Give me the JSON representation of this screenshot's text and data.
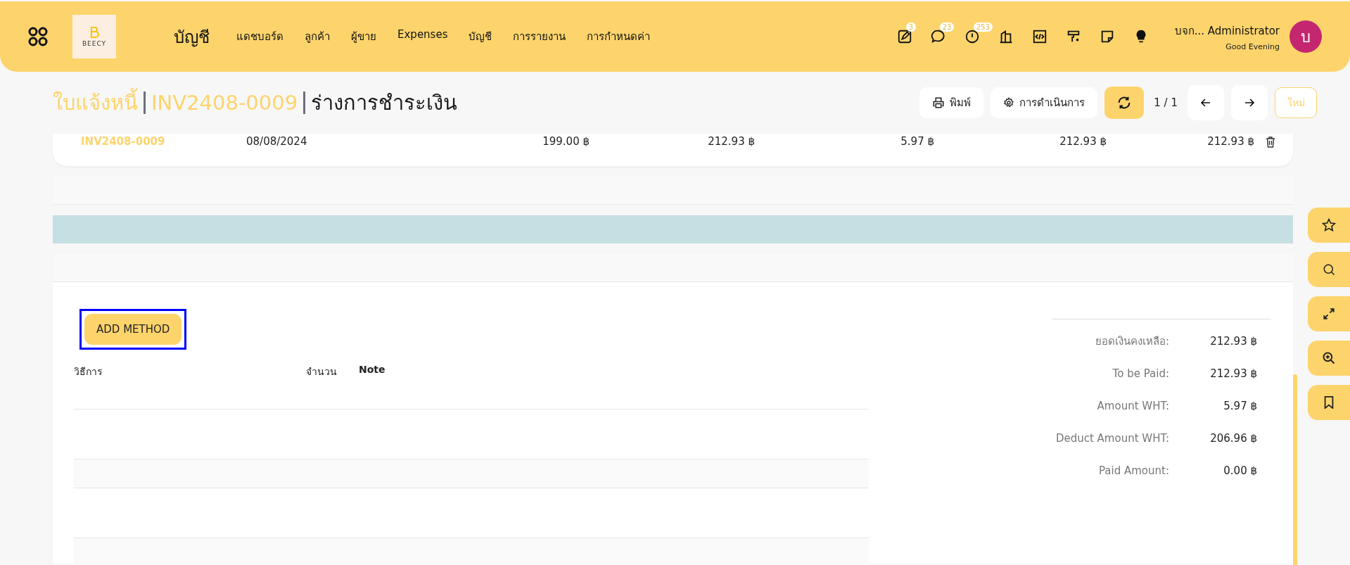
{
  "header": {
    "logo_text": "BEECY",
    "module_title": "บัญชี",
    "nav_items": [
      "แดชบอร์ด",
      "ลูกค้า",
      "ผู้ขาย",
      "Expenses",
      "บัญชี",
      "การรายงาน",
      "การกำหนดค่า"
    ],
    "icons": [
      {
        "kind": "note",
        "badge": "3"
      },
      {
        "kind": "chat",
        "badge": "23"
      },
      {
        "kind": "clock",
        "badge": "253"
      },
      {
        "kind": "building"
      },
      {
        "kind": "code"
      },
      {
        "kind": "brush"
      },
      {
        "kind": "sticky"
      },
      {
        "kind": "bulb"
      }
    ],
    "user": {
      "name": "บจก... Administrator",
      "greeting": "Good Evening",
      "avatar_letter": "บ"
    }
  },
  "breadcrumb": [
    {
      "label": "ใบแจ้งหนี้",
      "kind": "link"
    },
    {
      "label": "INV2408-0009",
      "kind": "link"
    },
    {
      "label": "ร่างการชำระเงิน",
      "kind": "current"
    }
  ],
  "toolbar": {
    "print": "พิมพ์",
    "actions": "การดำเนินการ",
    "pager": "1 / 1",
    "new": "ใหม่"
  },
  "invoice_row": {
    "number": "INV2408-0009",
    "date": "08/08/2024",
    "column_3": "199.00 ฿",
    "column_4": "212.93 ฿",
    "column_5": "5.97 ฿",
    "column_6": "212.93 ฿",
    "column_7": "212.93 ฿"
  },
  "payment": {
    "add_button": {
      "label": "ADD METHOD",
      "focused": true
    },
    "columns": [
      "วิธีการ",
      "จำนวน",
      "Note"
    ]
  },
  "summary": [
    {
      "label": "ยอดเงินคงเหลือ:",
      "value": "212.93 ฿"
    },
    {
      "label": "To be Paid:",
      "value": "212.93 ฿"
    },
    {
      "label": "Amount WHT:",
      "value": "5.97 ฿"
    },
    {
      "label": "Deduct Amount WHT:",
      "value": "206.96 ฿"
    },
    {
      "label": "Paid Amount:",
      "value": "0.00 ฿"
    }
  ]
}
